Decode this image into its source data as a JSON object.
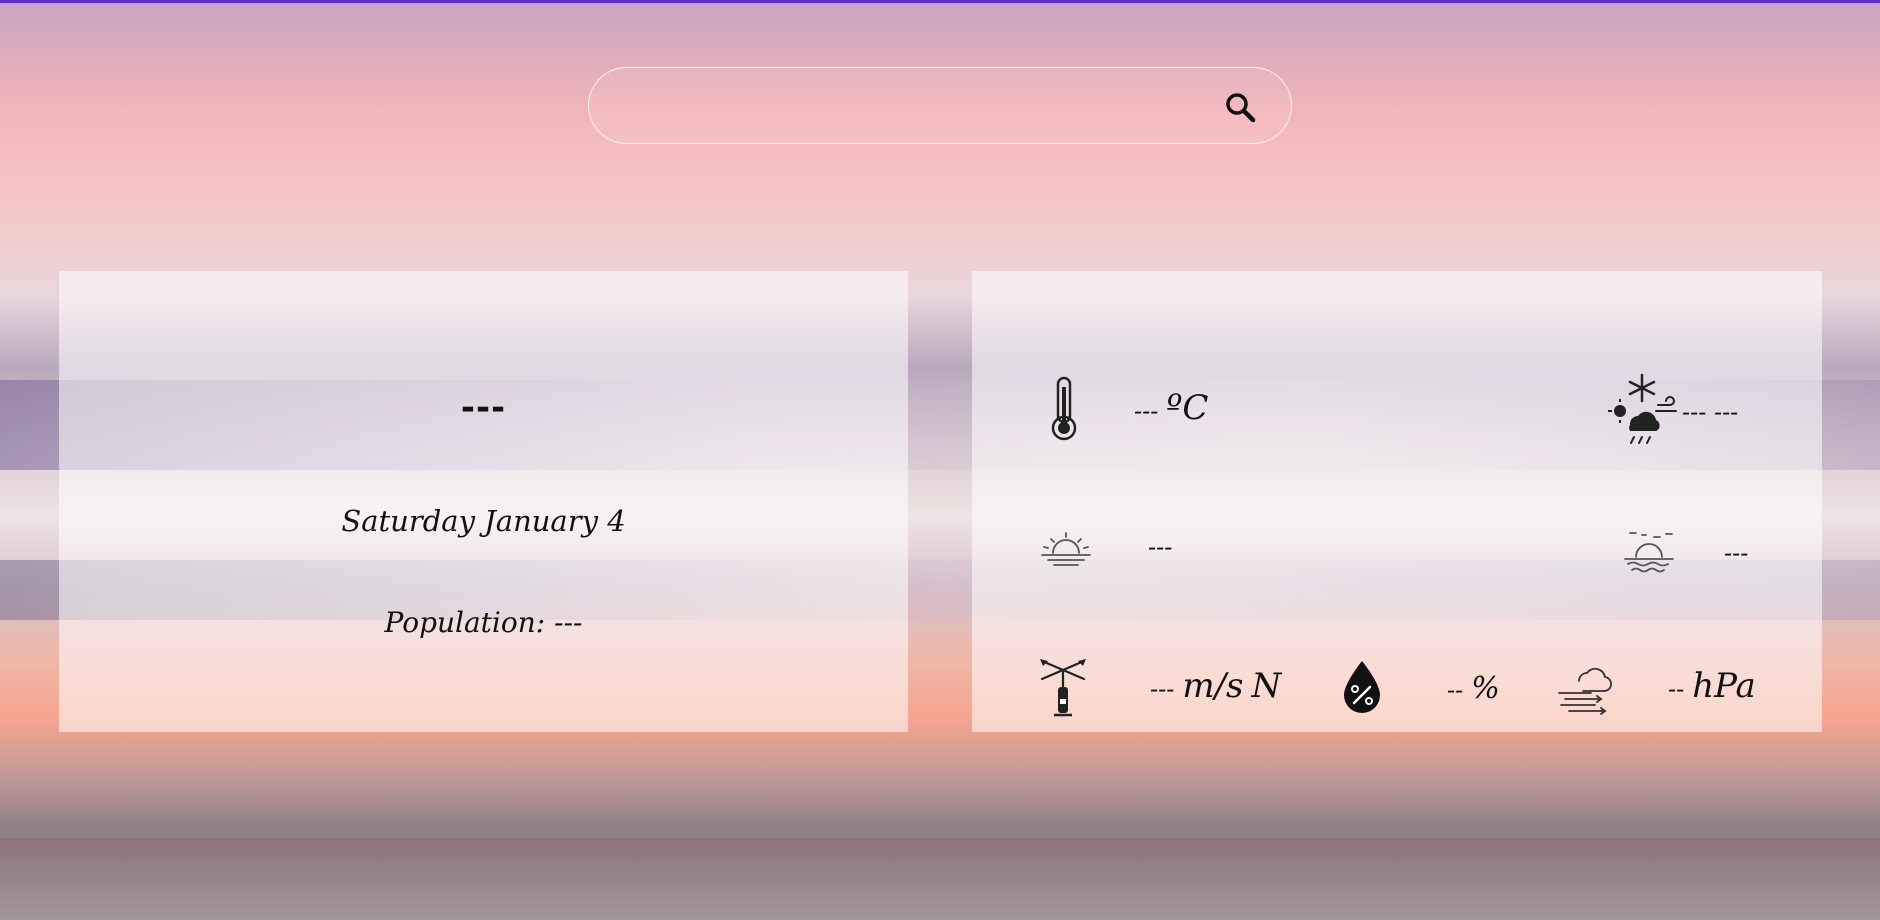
{
  "search": {
    "value": "",
    "placeholder": ""
  },
  "city_panel": {
    "city_name": "---",
    "date": "Saturday January 4",
    "population_label": "Population:",
    "population_value": "---"
  },
  "weather_panel": {
    "temperature": {
      "value": "---",
      "unit": "ºC"
    },
    "conditions": {
      "value": "--- ---"
    },
    "sunrise": {
      "value": "---"
    },
    "sunset": {
      "value": "---"
    },
    "wind": {
      "value": "---",
      "unit": "m/s",
      "direction": "N"
    },
    "humidity": {
      "value": "--",
      "unit": "%"
    },
    "pressure": {
      "value": "--",
      "unit": "hPa"
    }
  },
  "icons": {
    "search": "search-icon",
    "temperature": "thermometer-icon",
    "conditions": "weather-conditions-icon",
    "sunrise": "sunrise-icon",
    "sunset": "sunset-icon",
    "wind": "wind-vane-icon",
    "humidity": "humidity-drop-icon",
    "pressure": "pressure-cloud-icon"
  },
  "colors": {
    "top_accent": "#5a2bc7",
    "card_background": "rgba(255,255,255,0.55)",
    "text": "#111111"
  }
}
